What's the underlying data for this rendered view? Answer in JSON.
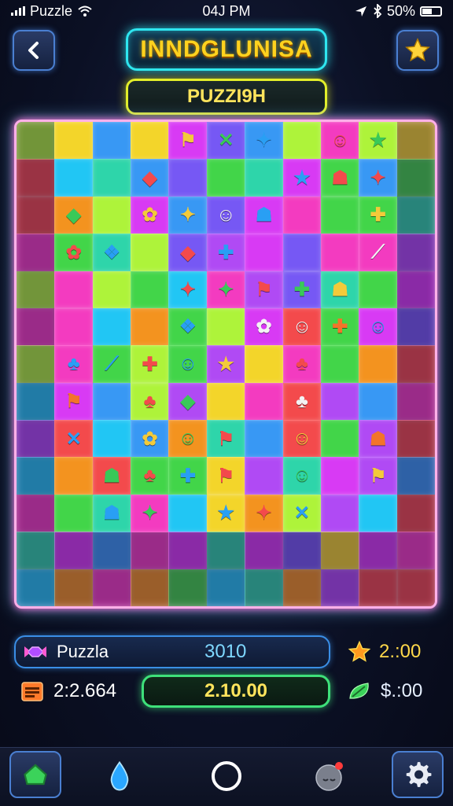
{
  "status_bar": {
    "carrier": "Puzzle",
    "time": "04J PM",
    "battery": "50%"
  },
  "header": {
    "back_icon": "chevron-left-icon",
    "title": "INNDGLUNISA",
    "subtitle": "PUZZI9H",
    "favorite_icon": "star-icon"
  },
  "board": {
    "rows": 13,
    "cols": 11,
    "palette": [
      "#ff3ec8",
      "#b84dff",
      "#3aa0ff",
      "#22d0ff",
      "#44e04a",
      "#b6ff3a",
      "#ffe02a",
      "#ff9a1e",
      "#ff4d4d",
      "#7b5cff",
      "#e23cff",
      "#2fe0b0"
    ],
    "glyphs": [
      "✕",
      "✦",
      "★",
      "◆",
      "⚑",
      "✿",
      "♣",
      "☗",
      "✚",
      "⟋",
      "❖",
      "☺"
    ]
  },
  "stats": {
    "left": [
      {
        "icon": "candy-icon",
        "label": "Puzzla",
        "value": "3010"
      },
      {
        "icon": "calendar-icon",
        "label": "2:2.664",
        "value": "2.10.00"
      }
    ],
    "right": [
      {
        "icon": "star-burst-icon",
        "value": "2.:00"
      },
      {
        "icon": "leaf-icon",
        "value": "$.:00"
      }
    ]
  },
  "nav": [
    {
      "name": "home-icon"
    },
    {
      "name": "droplet-icon"
    },
    {
      "name": "circle-icon"
    },
    {
      "name": "profile-icon"
    },
    {
      "name": "gear-icon"
    }
  ],
  "colors": {
    "accent_cyan": "#2ee6f0",
    "accent_yellow": "#e3ee2a",
    "accent_green": "#3ee07a",
    "board_border": "#ffb0e8"
  }
}
